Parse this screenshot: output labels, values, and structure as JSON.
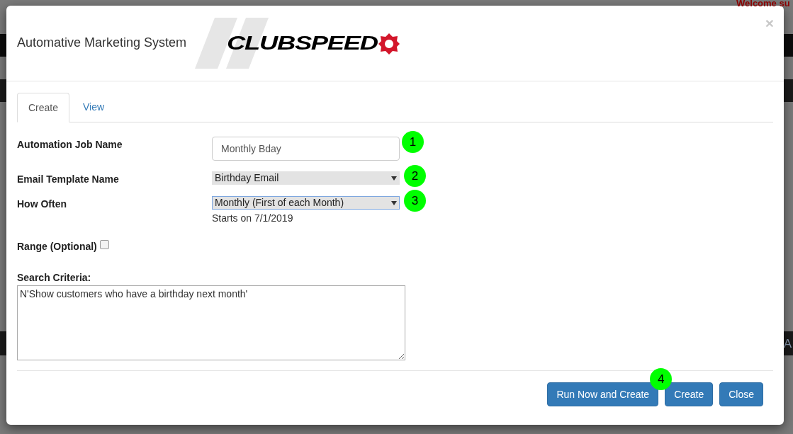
{
  "background": {
    "welcome_text": "Welcome su",
    "side_text": "A"
  },
  "modal": {
    "title": "Automative Marketing System",
    "logo_text": "CLUBSPEED",
    "close": "×"
  },
  "tabs": [
    {
      "label": "Create",
      "selected": true
    },
    {
      "label": "View",
      "selected": false
    }
  ],
  "fields": [
    {
      "kind": "text",
      "label": "Automation Job Name",
      "value": "Monthly Bday",
      "callout": "1"
    },
    {
      "kind": "select",
      "label": "Email Template Name",
      "value": "Birthday Email",
      "focused": false,
      "callout": "2"
    },
    {
      "kind": "select",
      "label": "How Often",
      "value": "Monthly (First of each Month)",
      "focused": true,
      "callout": "3",
      "hint": "Starts on 7/1/2019"
    },
    {
      "kind": "checkbox",
      "label": "Range (Optional)",
      "checked": false
    }
  ],
  "search_criteria": {
    "label": "Search Criteria:",
    "value": "N'Show customers who have a birthday next month'"
  },
  "buttons": [
    {
      "label": "Run Now and Create",
      "callout": "4"
    },
    {
      "label": "Create"
    },
    {
      "label": "Close"
    }
  ]
}
